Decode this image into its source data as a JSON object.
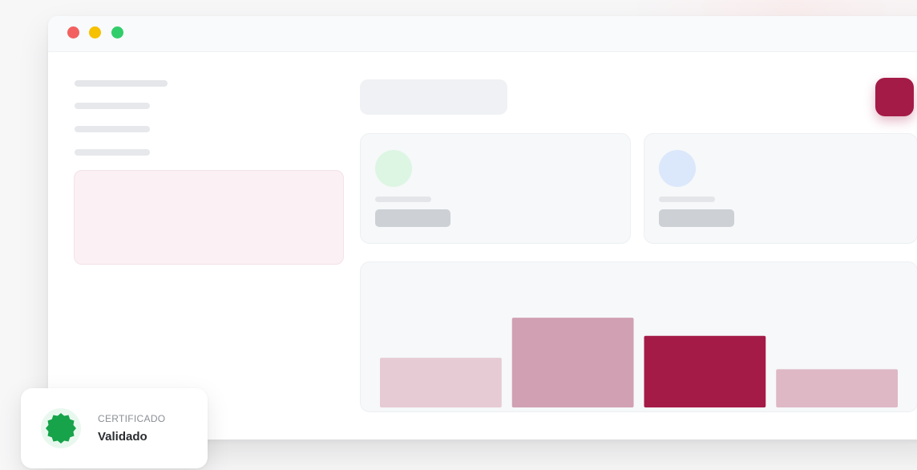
{
  "window": {
    "controls": [
      "close",
      "minimize",
      "maximize"
    ]
  },
  "certificate_badge": {
    "overline": "CERTIFICADO",
    "status": "Validado",
    "icon": "seal-check-icon",
    "color": "#16a34a"
  },
  "colors": {
    "accent": "#a41b47",
    "accent_soft": "#e6cbd4",
    "accent_mid": "#d1a0b2",
    "accent_light": "#deb8c5"
  },
  "chart_data": {
    "type": "bar",
    "categories": [
      "",
      "",
      "",
      ""
    ],
    "values": [
      52,
      94,
      75,
      40
    ],
    "ylim": [
      0,
      100
    ],
    "colors": [
      "#e6cbd4",
      "#d1a0b2",
      "#a41b47",
      "#deb8c5"
    ]
  }
}
